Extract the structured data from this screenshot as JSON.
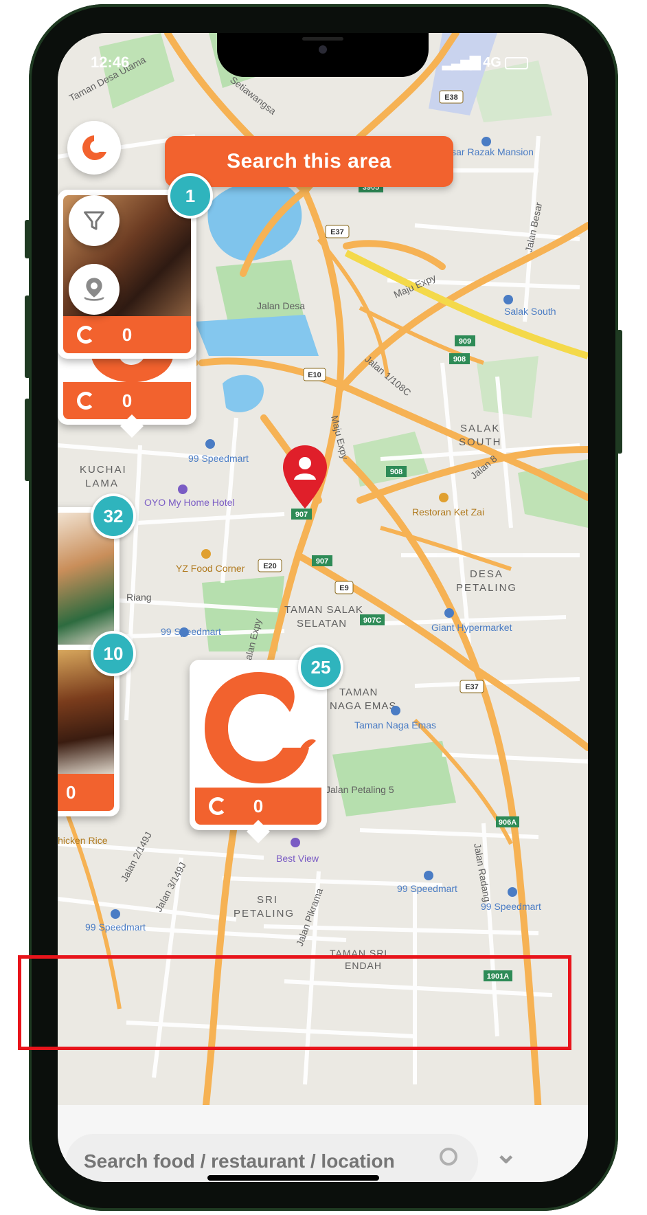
{
  "status_bar": {
    "time": "12:46",
    "network": "4G"
  },
  "header": {
    "search_area_label": "Search this area"
  },
  "map": {
    "labels": [
      {
        "text": "Taman Desa Utama",
        "id": "taman-desa-utama"
      },
      {
        "text": "Setiawangsa",
        "id": "setiawangsa"
      },
      {
        "text": "Pasar Razak Mansion",
        "id": "pasar-razak"
      },
      {
        "text": "Jalan Besar",
        "id": "jalan-besar"
      },
      {
        "text": "Jalan Desa",
        "id": "jalan-desa"
      },
      {
        "text": "Maju Expy",
        "id": "maju-expy-1"
      },
      {
        "text": "Salak South",
        "id": "salak-south-station"
      },
      {
        "text": "Jalan 1/108C",
        "id": "jalan-1-108c"
      },
      {
        "text": "SALAK",
        "id": "salak-1"
      },
      {
        "text": "SOUTH",
        "id": "salak-2"
      },
      {
        "text": "Maju Expy",
        "id": "maju-expy-2"
      },
      {
        "text": "Jalan 8",
        "id": "jalan-8"
      },
      {
        "text": "KUCHAI",
        "id": "kuchai-1"
      },
      {
        "text": "LAMA",
        "id": "kuchai-2"
      },
      {
        "text": "99 Speedmart",
        "id": "speedmart-1"
      },
      {
        "text": "OYO My Home Hotel",
        "id": "oyo-hotel"
      },
      {
        "text": "Restoran Ket Zai",
        "id": "restoran-ket-zai"
      },
      {
        "text": "YZ Food Corner",
        "id": "yz-food-corner"
      },
      {
        "text": "DESA",
        "id": "desa-1"
      },
      {
        "text": "PETALING",
        "id": "desa-2"
      },
      {
        "text": "Riang",
        "id": "riang"
      },
      {
        "text": "TAMAN SALAK",
        "id": "taman-salak-1"
      },
      {
        "text": "SELATAN",
        "id": "taman-salak-2"
      },
      {
        "text": "99 Speedmart",
        "id": "speedmart-2"
      },
      {
        "text": "Giant Hypermarket",
        "id": "giant"
      },
      {
        "text": "Jalan Expy",
        "id": "jalan-expy"
      },
      {
        "text": "TAMAN",
        "id": "taman-naga-1"
      },
      {
        "text": "NAGA EMAS",
        "id": "taman-naga-2"
      },
      {
        "text": "Taman Naga Emas",
        "id": "taman-naga-emas-station"
      },
      {
        "text": "Jalan Petaling 5",
        "id": "jalan-petaling-5"
      },
      {
        "text": "Best View",
        "id": "best-view"
      },
      {
        "text": "Jalan 2/149J",
        "id": "jalan-2-149j"
      },
      {
        "text": "Jalan 3/149J",
        "id": "jalan-3-149j"
      },
      {
        "text": "SRI",
        "id": "sri-1"
      },
      {
        "text": "PETALING",
        "id": "sri-2"
      },
      {
        "text": "Jalan Pikrama",
        "id": "jalan-pikrama"
      },
      {
        "text": "99 Speedmart",
        "id": "speedmart-3"
      },
      {
        "text": "99 Speedmart",
        "id": "speedmart-4"
      },
      {
        "text": "Jalan Radang",
        "id": "jalan-radang"
      },
      {
        "text": "TAMAN SRI",
        "id": "taman-sri-1"
      },
      {
        "text": "ENDAH",
        "id": "taman-sri-2"
      },
      {
        "text": "99 Speedmart",
        "id": "speedmart-5"
      },
      {
        "text": "Chicken Rice",
        "id": "chicken-rice"
      }
    ],
    "shields": [
      "E38",
      "3905",
      "E37",
      "909",
      "908",
      "E10",
      "908",
      "907",
      "E20",
      "907",
      "E9",
      "907C",
      "E37",
      "906A",
      "1901A"
    ]
  },
  "clusters": [
    {
      "id": "cluster-1",
      "badge": "1",
      "count": "0"
    },
    {
      "id": "cluster-back",
      "badge": "",
      "count": "0"
    },
    {
      "id": "cluster-32",
      "badge": "32",
      "count": ""
    },
    {
      "id": "cluster-10",
      "badge": "10",
      "count": "0"
    },
    {
      "id": "cluster-25",
      "badge": "25",
      "count": "0"
    }
  ],
  "search": {
    "placeholder": "Search food / restaurant / location"
  },
  "colors": {
    "brand": "#f2622e",
    "badge": "#2fb4bd",
    "road": "#f7b55b",
    "water": "#7fc4ec",
    "park": "#b6dfae"
  }
}
